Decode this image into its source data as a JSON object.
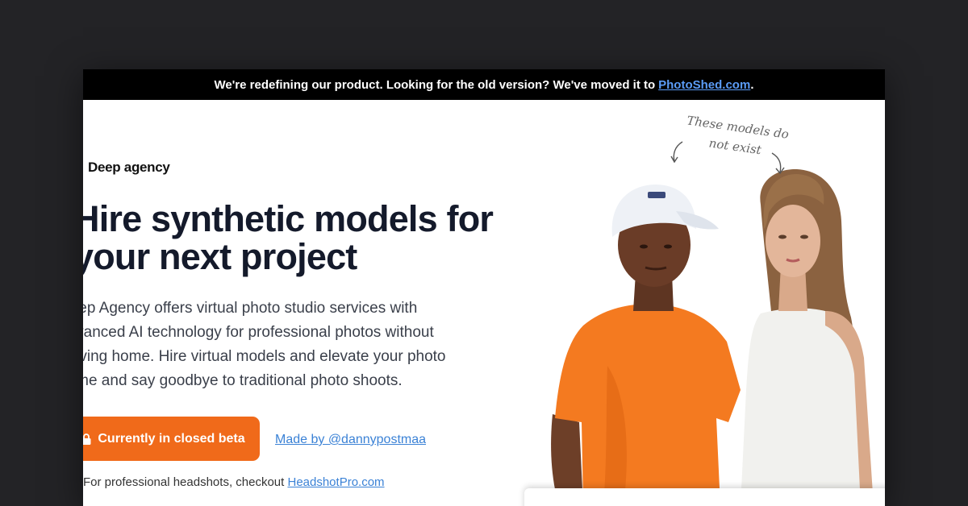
{
  "banner": {
    "text": "We're redefining our product. Looking for the old version? We've moved it to",
    "link_text": "PhotoShed.com",
    "suffix": "."
  },
  "brand": {
    "name": "Deep agency"
  },
  "hero": {
    "headline_line1": "Hire synthetic models for",
    "headline_line2": "your next project",
    "description_lines": [
      "Deep Agency offers virtual photo studio services with",
      "advanced AI technology for professional photos without",
      "leaving home. Hire virtual models and elevate your photo",
      "game and say goodbye to traditional photo shoots."
    ],
    "cta_label": "Currently in closed beta",
    "made_by": "Made by @dannypostmaa",
    "footnote_prefix": "For professional headshots, checkout",
    "footnote_link": "HeadshotPro.com"
  },
  "annotation": {
    "line1": "These models do",
    "line2": "not exist"
  },
  "colors": {
    "accent": "#f06a1a",
    "link": "#3b82d6",
    "banner_bg": "#000000",
    "page_bg": "#232326"
  },
  "icons": [
    "lock-icon",
    "arrow-left-icon",
    "arrow-right-icon"
  ]
}
